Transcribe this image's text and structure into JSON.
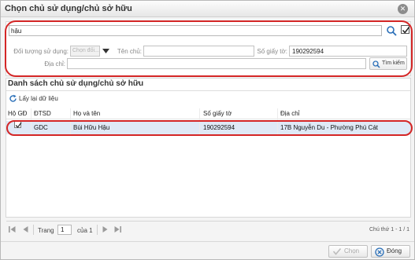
{
  "dialog": {
    "title": "Chọn chủ sử dụng/chủ sở hữu",
    "close_symbol": "✕"
  },
  "search": {
    "keyword_value": "hậu",
    "object_type_label": "Đối tượng sử dụng:",
    "object_type_value": "Chọn đối...",
    "owner_name_label": "Tên chủ:",
    "owner_name_value": "",
    "doc_number_label": "Số giấy tờ:",
    "doc_number_value": "190292594",
    "address_label": "Địa chỉ:",
    "address_value": "",
    "search_button_label": "Tìm kiếm"
  },
  "list": {
    "title": "Danh sách chủ sử dụng/chủ sở hữu",
    "reload_label": "Lấy lại dữ liệu",
    "columns": [
      "Hộ GĐ",
      "ĐTSD",
      "Họ và tên",
      "Số giấy tờ",
      "Địa chỉ"
    ],
    "rows": [
      {
        "household": true,
        "dtsd": "GDC",
        "full_name": "Bùi Hữu Hậu",
        "doc_number": "190292594",
        "address": "17B Nguyễn Du - Phường Phú Cát"
      }
    ]
  },
  "pager": {
    "page_label": "Trang",
    "page_value": "1",
    "of_label": "của 1",
    "status": "Chú thứ 1 - 1 / 1"
  },
  "footer": {
    "choose_label": "Chọn",
    "close_label": "Đóng"
  },
  "colors": {
    "highlight_oval": "#d42626",
    "selected_row": "#dfe9f6",
    "icon_blue": "#2a6fb8"
  }
}
